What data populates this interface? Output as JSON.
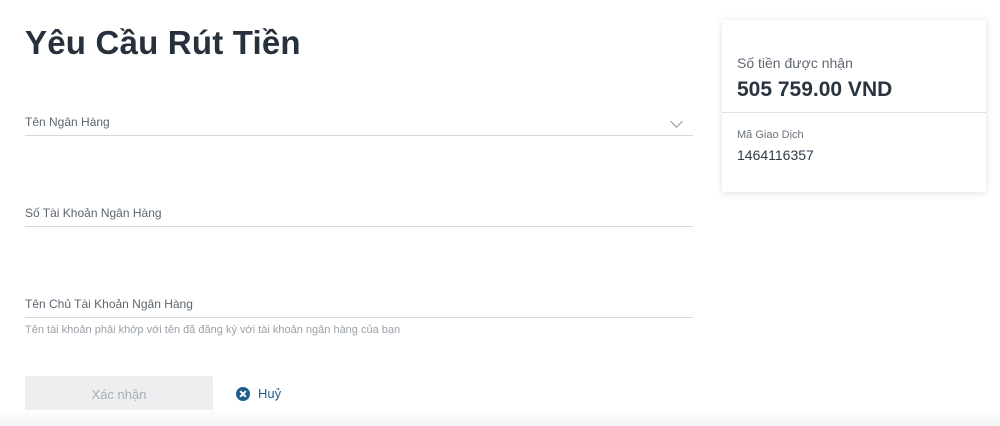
{
  "form": {
    "title": "Yêu Cầu Rút Tiền",
    "bank_name": {
      "label": "Tên Ngân Hàng"
    },
    "account_number": {
      "label": "Số Tài Khoản Ngân Hàng"
    },
    "account_holder": {
      "label": "Tên Chủ Tài Khoản Ngân Hàng",
      "helper": "Tên tài khoản phải khớp với tên đã đăng ký với tài khoản ngân hàng của bạn"
    },
    "confirm_label": "Xác nhận",
    "cancel_label": "Huỷ"
  },
  "summary": {
    "amount_label": "Số tiền được nhận",
    "amount_value": "505 759.00 VND",
    "transaction_label": "Mã Giao Dịch",
    "transaction_id": "1464116357"
  },
  "icons": {
    "dropdown": "chevron-down-icon",
    "cancel": "close-circle-icon"
  },
  "colors": {
    "accent": "#1f5e8c",
    "disabled_button": "#eceeef"
  }
}
